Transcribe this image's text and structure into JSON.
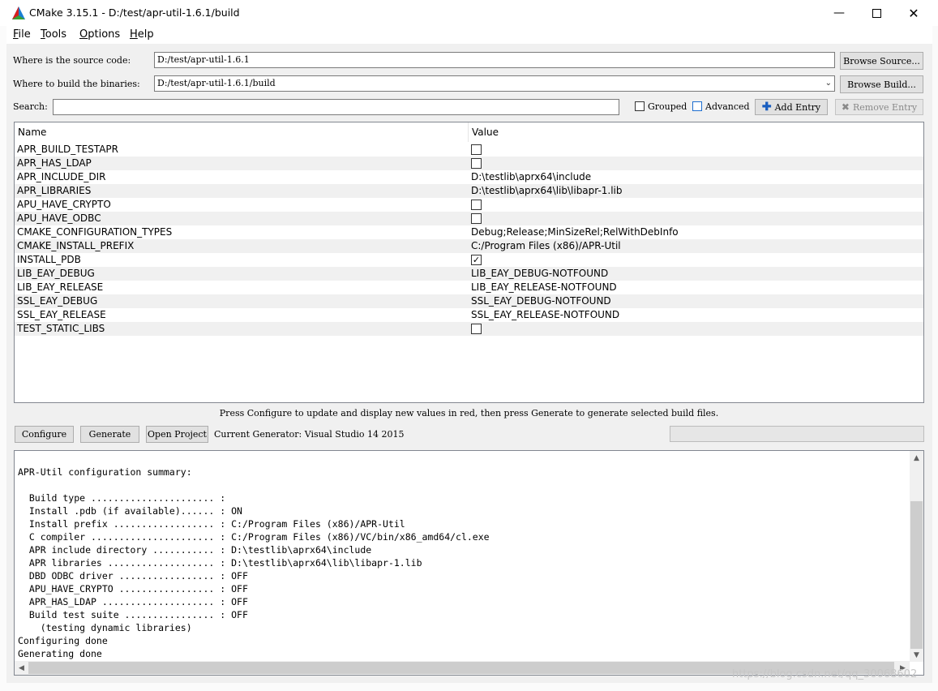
{
  "window": {
    "title": "CMake 3.15.1 - D:/test/apr-util-1.6.1/build"
  },
  "menu": [
    {
      "pre": "",
      "key": "F",
      "rest": "ile"
    },
    {
      "pre": "",
      "key": "T",
      "rest": "ools"
    },
    {
      "pre": "",
      "key": "O",
      "rest": "ptions"
    },
    {
      "pre": "",
      "key": "H",
      "rest": "elp"
    }
  ],
  "source": {
    "label": "Where is the source code:",
    "value": "D:/test/apr-util-1.6.1",
    "browse_label": "Browse Source..."
  },
  "build": {
    "label": "Where to build the binaries:",
    "value": "D:/test/apr-util-1.6.1/build",
    "browse_label": "Browse Build..."
  },
  "search": {
    "label": "Search:",
    "value": ""
  },
  "options": {
    "grouped_label": "Grouped",
    "advanced_label": "Advanced",
    "add_entry_label": "Add Entry",
    "remove_entry_label": "Remove Entry"
  },
  "table": {
    "headers": {
      "name": "Name",
      "value": "Value"
    },
    "rows": [
      {
        "name": "APR_BUILD_TESTAPR",
        "type": "bool",
        "checked": false
      },
      {
        "name": "APR_HAS_LDAP",
        "type": "bool",
        "checked": false
      },
      {
        "name": "APR_INCLUDE_DIR",
        "type": "text",
        "value": "D:\\testlib\\aprx64\\include"
      },
      {
        "name": "APR_LIBRARIES",
        "type": "text",
        "value": "D:\\testlib\\aprx64\\lib\\libapr-1.lib"
      },
      {
        "name": "APU_HAVE_CRYPTO",
        "type": "bool",
        "checked": false
      },
      {
        "name": "APU_HAVE_ODBC",
        "type": "bool",
        "checked": false
      },
      {
        "name": "CMAKE_CONFIGURATION_TYPES",
        "type": "text",
        "value": "Debug;Release;MinSizeRel;RelWithDebInfo"
      },
      {
        "name": "CMAKE_INSTALL_PREFIX",
        "type": "text",
        "value": "C:/Program Files (x86)/APR-Util"
      },
      {
        "name": "INSTALL_PDB",
        "type": "bool",
        "checked": true
      },
      {
        "name": "LIB_EAY_DEBUG",
        "type": "text",
        "value": "LIB_EAY_DEBUG-NOTFOUND"
      },
      {
        "name": "LIB_EAY_RELEASE",
        "type": "text",
        "value": "LIB_EAY_RELEASE-NOTFOUND"
      },
      {
        "name": "SSL_EAY_DEBUG",
        "type": "text",
        "value": "SSL_EAY_DEBUG-NOTFOUND"
      },
      {
        "name": "SSL_EAY_RELEASE",
        "type": "text",
        "value": "SSL_EAY_RELEASE-NOTFOUND"
      },
      {
        "name": "TEST_STATIC_LIBS",
        "type": "bool",
        "checked": false
      }
    ]
  },
  "hint": "Press Configure to update and display new values in red, then press Generate to generate selected build files.",
  "actions": {
    "configure_label": "Configure",
    "generate_label": "Generate",
    "open_project_label": "Open Project",
    "generator": "Current Generator: Visual Studio 14 2015"
  },
  "output": {
    "lines": [
      "",
      "APR-Util configuration summary:",
      "",
      "  Build type ...................... :",
      "  Install .pdb (if available)...... : ON",
      "  Install prefix .................. : C:/Program Files (x86)/APR-Util",
      "  C compiler ...................... : C:/Program Files (x86)/VC/bin/x86_amd64/cl.exe",
      "  APR include directory ........... : D:\\testlib\\aprx64\\include",
      "  APR libraries ................... : D:\\testlib\\aprx64\\lib\\libapr-1.lib",
      "  DBD ODBC driver ................. : OFF",
      "  APU_HAVE_CRYPTO ................. : OFF",
      "  APR_HAS_LDAP .................... : OFF",
      "  Build test suite ................ : OFF",
      "    (testing dynamic libraries)",
      "Configuring done",
      "Generating done"
    ]
  },
  "progress": 0,
  "watermark": "https://blog.csdn.net/qq_30068602"
}
